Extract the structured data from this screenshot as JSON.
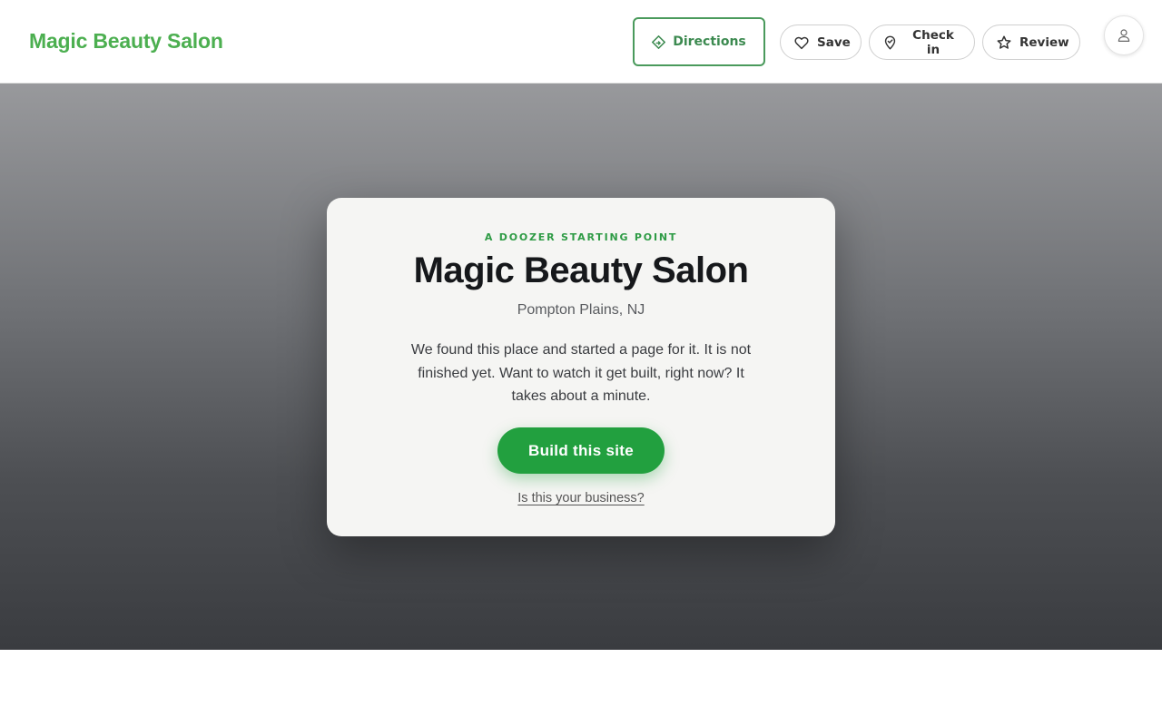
{
  "header": {
    "brand": "Magic Beauty Salon",
    "directions_label": "Directions",
    "save_label": "Save",
    "checkin_label": "Check in",
    "review_label": "Review"
  },
  "card": {
    "eyebrow": "A DOOZER STARTING POINT",
    "title": "Magic Beauty Salon",
    "location": "Pompton Plains, NJ",
    "description": "We found this place and started a page for it. It is not finished yet. Want to watch it get built, right now? It takes about a minute.",
    "cta_label": "Build this site",
    "claim_link": "Is this your business?"
  },
  "icons": {
    "directions": "directions-diamond-icon",
    "save": "heart-icon",
    "checkin": "location-pin-icon",
    "review": "star-icon",
    "avatar": "user-icon"
  },
  "colors": {
    "brand_green": "#4caf50",
    "cta_green": "#22a03f",
    "eyebrow_green": "#2e9b45"
  }
}
